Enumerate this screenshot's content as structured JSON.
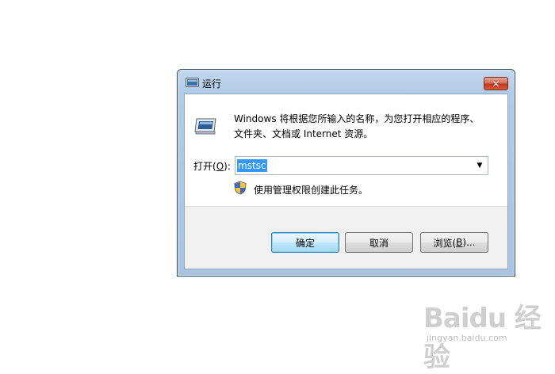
{
  "window": {
    "title": "运行",
    "close_label": "✕"
  },
  "dialog": {
    "description_line1": "Windows 将根据您所输入的名称，为您打开相应的程序、",
    "description_line2": "文件夹、文档或 Internet 资源。",
    "open_label_prefix": "打开(",
    "open_label_hotkey": "O",
    "open_label_suffix": "):",
    "open_value": "mstsc",
    "admin_note": "使用管理权限创建此任务。"
  },
  "buttons": {
    "ok": "确定",
    "cancel": "取消",
    "browse_prefix": "浏览(",
    "browse_hotkey": "B",
    "browse_suffix": ")..."
  },
  "watermark": {
    "logo": "Baidu 经验",
    "url": "jingyan.baidu.com"
  },
  "icons": {
    "title": "run-icon",
    "main": "run-icon",
    "shield": "uac-shield-icon",
    "dropdown": "chevron-down-icon"
  },
  "colors": {
    "selection": "#3399ff",
    "close_button": "#c0381d",
    "frame": "#b2cbe6"
  }
}
